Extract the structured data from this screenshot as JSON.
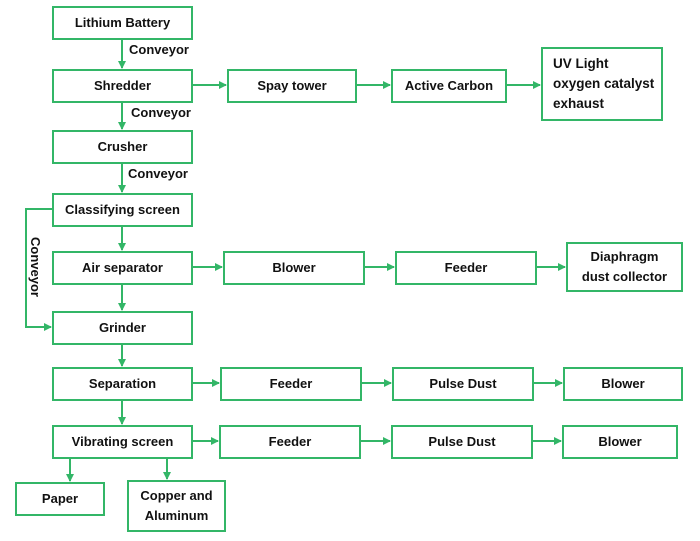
{
  "diagram": {
    "accent_color": "#33b667",
    "nodes": {
      "lithium_battery": "Lithium Battery",
      "shredder": "Shredder",
      "spay_tower": "Spay tower",
      "active_carbon": "Active Carbon",
      "uv_light": "UV Light\noxygen catalyst\nexhaust",
      "crusher": "Crusher",
      "classifying_screen": "Classifying screen",
      "air_separator": "Air separator",
      "air_blower": "Blower",
      "air_feeder": "Feeder",
      "diaphragm": "Diaphragm\ndust collector",
      "grinder": "Grinder",
      "separation": "Separation",
      "sep_feeder": "Feeder",
      "sep_pulse_dust": "Pulse Dust",
      "sep_blower": "Blower",
      "vibrating_screen": "Vibrating screen",
      "vib_feeder": "Feeder",
      "vib_pulse_dust": "Pulse Dust",
      "vib_blower": "Blower",
      "paper": "Paper",
      "copper_aluminum": "Copper and\nAluminum"
    },
    "edge_labels": {
      "battery_to_shredder": "Conveyor",
      "shredder_to_crusher": "Conveyor",
      "crusher_to_classifying": "Conveyor",
      "classifying_to_grinder": "Conveyor"
    },
    "edges": [
      [
        "lithium_battery",
        "shredder"
      ],
      [
        "shredder",
        "spay_tower"
      ],
      [
        "spay_tower",
        "active_carbon"
      ],
      [
        "active_carbon",
        "uv_light"
      ],
      [
        "shredder",
        "crusher"
      ],
      [
        "crusher",
        "classifying_screen"
      ],
      [
        "classifying_screen",
        "air_separator"
      ],
      [
        "classifying_screen",
        "grinder"
      ],
      [
        "air_separator",
        "air_blower"
      ],
      [
        "air_blower",
        "air_feeder"
      ],
      [
        "air_feeder",
        "diaphragm"
      ],
      [
        "air_separator",
        "grinder"
      ],
      [
        "grinder",
        "separation"
      ],
      [
        "separation",
        "sep_feeder"
      ],
      [
        "sep_feeder",
        "sep_pulse_dust"
      ],
      [
        "sep_pulse_dust",
        "sep_blower"
      ],
      [
        "separation",
        "vibrating_screen"
      ],
      [
        "vibrating_screen",
        "vib_feeder"
      ],
      [
        "vib_feeder",
        "vib_pulse_dust"
      ],
      [
        "vib_pulse_dust",
        "vib_blower"
      ],
      [
        "vibrating_screen",
        "paper"
      ],
      [
        "vibrating_screen",
        "copper_aluminum"
      ]
    ]
  }
}
